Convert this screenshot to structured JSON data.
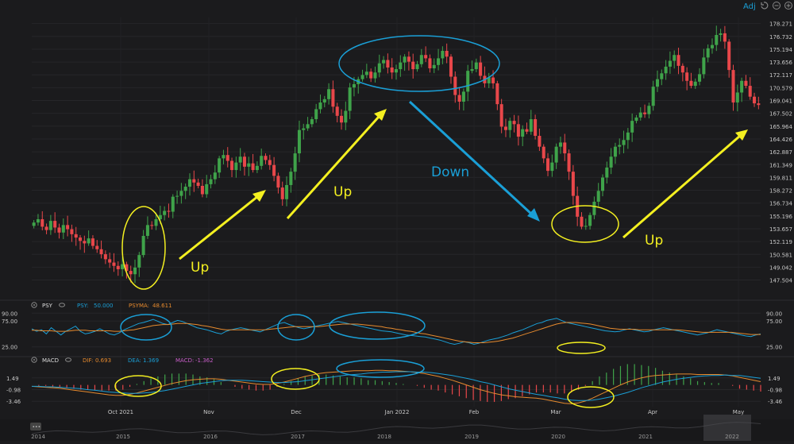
{
  "toolbar": {
    "adj_label": "Adj",
    "undo_icon": "undo-icon",
    "minus_icon": "zoom-out-icon",
    "plus_icon": "zoom-in-icon"
  },
  "price_axis": {
    "labels": [
      "178.271",
      "176.732",
      "175.194",
      "173.656",
      "172.117",
      "170.579",
      "169.041",
      "167.502",
      "165.964",
      "164.426",
      "162.887",
      "161.349",
      "159.811",
      "158.272",
      "156.734",
      "155.196",
      "153.657",
      "152.119",
      "150.581",
      "149.042",
      "147.504"
    ]
  },
  "psy_panel": {
    "name": "PSY",
    "psy_label": "PSY:",
    "psy_value": "50.000",
    "psyma_label": "PSYMA:",
    "psyma_value": "48.611",
    "axis_labels": [
      "90.00",
      "75.00",
      "25.00"
    ]
  },
  "macd_panel": {
    "name": "MACD",
    "dif_label": "DIF:",
    "dif_value": "0.693",
    "dea_label": "DEA:",
    "dea_value": "1.369",
    "macd_label": "MACD:",
    "macd_value": "-1.362",
    "axis_labels": [
      "1.49",
      "-0.98",
      "-3.46"
    ]
  },
  "time_axis": {
    "labels": [
      "Oct 2021",
      "Nov",
      "Dec",
      "Jan 2022",
      "Feb",
      "Mar",
      "Apr",
      "May"
    ]
  },
  "navigator": {
    "years": [
      "2014",
      "2015",
      "2016",
      "2017",
      "2018",
      "2019",
      "2020",
      "2021",
      "2022"
    ],
    "handle_label": "•••"
  },
  "annotations": {
    "up_labels": [
      "Up",
      "Up",
      "Up"
    ],
    "down_label": "Down"
  },
  "colors": {
    "up": "#3fa34a",
    "down": "#e8474a",
    "yellow": "#f4f020",
    "blue": "#1a9fd6",
    "psy": "#1a9fd6",
    "psyma": "#e68a2e",
    "dif": "#e68a2e",
    "dea": "#1a9fd6"
  },
  "chart_data": {
    "type": "candlestick",
    "ylim": [
      146.7,
      179.0
    ],
    "x_ticks": [
      "Oct 2021",
      "Nov",
      "Dec",
      "Jan 2022",
      "Feb",
      "Mar",
      "Apr",
      "May"
    ],
    "closes": [
      154.4,
      154.8,
      153.9,
      153.5,
      154.6,
      153.8,
      153.2,
      154.1,
      153.6,
      153.0,
      152.6,
      152.2,
      151.9,
      152.5,
      151.6,
      151.2,
      150.6,
      150.0,
      149.6,
      149.2,
      148.8,
      149.4,
      148.6,
      148.2,
      149.0,
      150.5,
      152.8,
      154.1,
      154.0,
      154.8,
      155.3,
      155.8,
      155.7,
      157.5,
      157.6,
      158.2,
      158.7,
      159.6,
      159.2,
      158.8,
      157.8,
      159.0,
      159.6,
      160.4,
      162.1,
      162.5,
      161.8,
      160.7,
      161.6,
      162.3,
      161.1,
      161.5,
      160.7,
      161.2,
      162.4,
      161.9,
      161.3,
      160.0,
      158.6,
      157.2,
      158.9,
      160.5,
      162.7,
      165.5,
      165.7,
      166.2,
      166.8,
      168.0,
      168.8,
      169.2,
      170.4,
      168.3,
      167.2,
      166.4,
      167.8,
      170.6,
      171.0,
      171.6,
      172.1,
      172.5,
      171.7,
      172.4,
      173.5,
      173.9,
      173.0,
      172.4,
      172.8,
      173.6,
      174.3,
      173.7,
      172.8,
      173.4,
      174.5,
      174.1,
      172.9,
      173.3,
      174.1,
      175.0,
      174.3,
      171.9,
      169.7,
      168.9,
      170.1,
      172.6,
      172.8,
      173.6,
      172.0,
      171.1,
      171.8,
      171.1,
      168.6,
      165.9,
      165.5,
      166.6,
      166.2,
      164.7,
      165.6,
      165.3,
      166.8,
      164.8,
      163.5,
      162.1,
      160.6,
      161.6,
      163.5,
      164.0,
      162.7,
      160.5,
      157.6,
      155.1,
      153.9,
      154.0,
      155.3,
      156.9,
      158.2,
      159.8,
      161.0,
      162.3,
      163.5,
      163.7,
      164.3,
      165.2,
      166.6,
      167.0,
      167.6,
      167.4,
      168.4,
      170.7,
      171.6,
      172.3,
      173.1,
      173.8,
      174.5,
      173.2,
      172.4,
      171.4,
      170.8,
      171.3,
      172.2,
      174.2,
      175.3,
      175.7,
      176.9,
      177.1,
      176.1,
      172.7,
      168.8,
      170.0,
      171.4,
      170.8,
      169.5,
      168.7,
      168.5
    ],
    "psy": {
      "values": [
        60,
        55,
        58,
        50,
        62,
        55,
        48,
        55,
        60,
        65,
        55,
        50,
        52,
        55,
        60,
        55,
        50,
        48,
        52,
        58,
        62,
        66,
        70,
        72,
        75,
        78,
        74,
        70,
        68,
        72,
        76,
        74,
        70,
        66,
        62,
        60,
        58,
        55,
        52,
        50,
        55,
        58,
        60,
        62,
        60,
        58,
        56,
        54,
        58,
        62,
        66,
        70,
        72,
        68,
        65,
        62,
        60,
        62,
        64,
        66,
        68,
        70,
        72,
        74,
        72,
        70,
        68,
        66,
        64,
        62,
        60,
        58,
        56,
        55,
        54,
        52,
        50,
        48,
        47,
        46,
        45,
        44,
        42,
        40,
        38,
        35,
        32,
        30,
        32,
        35,
        33,
        30,
        32,
        35,
        38,
        40,
        42,
        45,
        48,
        52,
        55,
        58,
        62,
        66,
        70,
        72,
        76,
        78,
        80,
        76,
        72,
        70,
        68,
        66,
        64,
        62,
        60,
        58,
        56,
        55,
        54,
        55,
        58,
        60,
        58,
        56,
        54,
        55,
        58,
        60,
        62,
        60,
        58,
        56,
        54,
        52,
        50,
        48,
        50,
        52,
        55,
        58,
        56,
        54,
        52,
        50,
        48,
        46,
        45,
        48,
        50
      ],
      "ma": [
        57,
        57,
        56,
        56,
        56,
        55,
        55,
        55,
        56,
        57,
        57,
        57,
        56,
        56,
        56,
        56,
        56,
        55,
        55,
        56,
        57,
        58,
        60,
        62,
        64,
        66,
        67,
        68,
        68,
        69,
        70,
        70,
        70,
        69,
        68,
        66,
        65,
        63,
        61,
        59,
        58,
        58,
        58,
        58,
        58,
        58,
        58,
        58,
        58,
        59,
        60,
        61,
        62,
        63,
        64,
        64,
        64,
        64,
        64,
        64,
        65,
        66,
        67,
        68,
        69,
        69,
        69,
        69,
        68,
        67,
        66,
        65,
        64,
        62,
        61,
        59,
        58,
        56,
        55,
        53,
        51,
        50,
        48,
        46,
        44,
        42,
        40,
        38,
        36,
        35,
        34,
        33,
        33,
        33,
        34,
        35,
        36,
        38,
        40,
        42,
        45,
        48,
        51,
        54,
        57,
        60,
        63,
        66,
        69,
        71,
        72,
        72,
        72,
        71,
        70,
        69,
        67,
        65,
        63,
        61,
        60,
        59,
        59,
        59,
        59,
        58,
        58,
        58,
        58,
        58,
        58,
        58,
        58,
        58,
        57,
        56,
        55,
        54,
        53,
        53,
        53,
        53,
        53,
        53,
        53,
        52,
        51,
        50,
        49,
        49,
        49
      ]
    },
    "macd": {
      "dif": [
        -0.3,
        -0.4,
        -0.5,
        -0.6,
        -0.7,
        -0.9,
        -1.1,
        -1.3,
        -1.5,
        -1.7,
        -1.9,
        -2.1,
        -2.2,
        -2.2,
        -2.0,
        -1.7,
        -1.3,
        -0.9,
        -0.5,
        -0.1,
        0.3,
        0.6,
        0.9,
        1.1,
        1.2,
        1.3,
        1.3,
        1.2,
        1.0,
        0.8,
        0.6,
        0.4,
        0.2,
        0.1,
        0.1,
        0.3,
        0.6,
        1.0,
        1.4,
        1.8,
        2.1,
        2.4,
        2.6,
        2.7,
        2.8,
        2.9,
        3.0,
        3.0,
        3.0,
        3.1,
        3.1,
        3.0,
        3.0,
        2.9,
        2.8,
        2.6,
        2.4,
        2.1,
        1.8,
        1.4,
        1.0,
        0.5,
        0.0,
        -0.5,
        -1.0,
        -1.4,
        -1.8,
        -2.1,
        -2.3,
        -2.5,
        -2.6,
        -2.7,
        -2.8,
        -3.0,
        -3.3,
        -3.6,
        -3.9,
        -4.0,
        -3.8,
        -3.4,
        -2.8,
        -2.1,
        -1.4,
        -0.7,
        0.0,
        0.6,
        1.1,
        1.5,
        1.8,
        2.0,
        2.1,
        2.2,
        2.3,
        2.3,
        2.3,
        2.2,
        2.2,
        2.2,
        2.2,
        2.1,
        1.9,
        1.6,
        1.3,
        1.0,
        0.7
      ],
      "dea": [
        -0.3,
        -0.3,
        -0.4,
        -0.4,
        -0.5,
        -0.6,
        -0.7,
        -0.8,
        -1.0,
        -1.1,
        -1.3,
        -1.5,
        -1.6,
        -1.7,
        -1.8,
        -1.8,
        -1.7,
        -1.6,
        -1.4,
        -1.2,
        -0.9,
        -0.6,
        -0.3,
        0.0,
        0.3,
        0.5,
        0.7,
        0.9,
        1.0,
        1.0,
        1.0,
        0.9,
        0.8,
        0.7,
        0.6,
        0.5,
        0.5,
        0.6,
        0.7,
        0.9,
        1.1,
        1.3,
        1.5,
        1.7,
        1.9,
        2.1,
        2.2,
        2.3,
        2.5,
        2.6,
        2.7,
        2.7,
        2.8,
        2.8,
        2.8,
        2.7,
        2.7,
        2.6,
        2.4,
        2.2,
        2.0,
        1.7,
        1.4,
        1.1,
        0.7,
        0.4,
        0.0,
        -0.4,
        -0.8,
        -1.1,
        -1.4,
        -1.7,
        -2.0,
        -2.2,
        -2.5,
        -2.7,
        -3.0,
        -3.2,
        -3.3,
        -3.3,
        -3.2,
        -3.0,
        -2.7,
        -2.4,
        -2.0,
        -1.6,
        -1.1,
        -0.6,
        -0.2,
        0.2,
        0.6,
        0.9,
        1.2,
        1.4,
        1.6,
        1.8,
        1.9,
        2.0,
        2.0,
        2.1,
        2.0,
        2.0,
        1.8,
        1.6,
        1.4
      ]
    }
  }
}
